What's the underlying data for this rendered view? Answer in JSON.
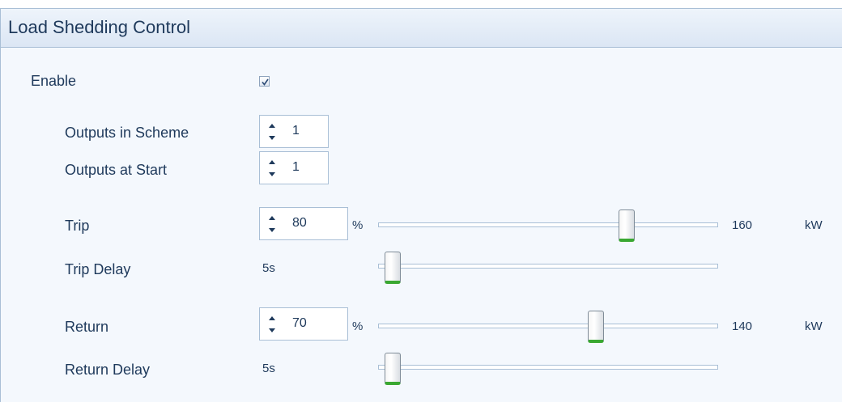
{
  "panel": {
    "title": "Load Shedding Control"
  },
  "enable": {
    "label": "Enable",
    "checked": true
  },
  "outputs_in_scheme": {
    "label": "Outputs in Scheme",
    "value": "1"
  },
  "outputs_at_start": {
    "label": "Outputs at Start",
    "value": "1"
  },
  "trip": {
    "label": "Trip",
    "value": "80",
    "unit": "%",
    "kw_value": "160",
    "kw_unit": "kW",
    "slider_percent": 75
  },
  "trip_delay": {
    "label": "Trip Delay",
    "value": "5s",
    "slider_percent": 0
  },
  "return": {
    "label": "Return",
    "value": "70",
    "unit": "%",
    "kw_value": "140",
    "kw_unit": "kW",
    "slider_percent": 65
  },
  "return_delay": {
    "label": "Return Delay",
    "value": "5s",
    "slider_percent": 0
  },
  "colors": {
    "accent_text": "#1e395b",
    "border": "#a9bfd6",
    "thumb_accent": "#3aa832"
  }
}
